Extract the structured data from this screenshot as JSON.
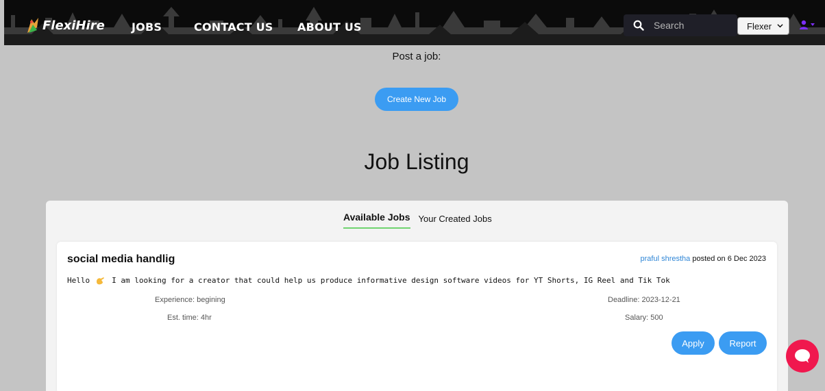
{
  "nav": {
    "brand": "FlexiHire",
    "links": [
      "JOBS",
      "CONTACT US",
      "ABOUT US"
    ],
    "search_placeholder": "Search",
    "role_selected": "Flexer",
    "icons": {
      "search": "search-icon",
      "user": "user-icon",
      "dropdown": "chevron-down-icon"
    }
  },
  "main": {
    "post_label": "Post a job:",
    "create_button": "Create New Job",
    "listing_title": "Job Listing",
    "tabs": [
      {
        "label": "Available Jobs",
        "active": true
      },
      {
        "label": "Your Created Jobs",
        "active": false
      }
    ]
  },
  "job": {
    "title": "social media handlig",
    "poster": "praful shrestha",
    "posted_text": " posted on 6 Dec 2023",
    "desc_prefix": "Hello",
    "desc_text": "I am looking for a creator that could help us produce informative design software videos for YT Shorts, IG Reel and Tik Tok",
    "experience": "Experience: begining",
    "est_time": "Est. time: 4hr",
    "deadline": "Deadline: 2023-12-21",
    "salary": "Salary: 500",
    "apply_label": "Apply",
    "report_label": "Report"
  },
  "colors": {
    "accent": "#3b9cf2",
    "nav_bg": "#0b0b0b",
    "page_bg": "#c4c4c4",
    "tab_underline": "#6fd46f",
    "link": "#2f86d6",
    "chat_fab": "#f0184e",
    "user_icon": "#7b2ff7"
  }
}
